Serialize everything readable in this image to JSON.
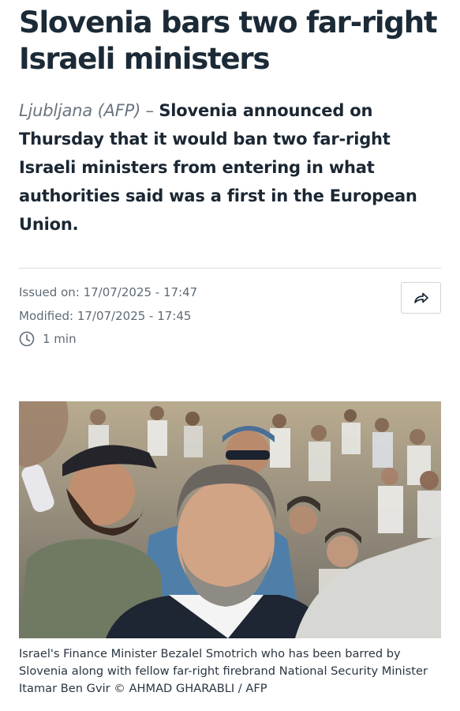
{
  "article": {
    "headline": "Slovenia bars two far-right Israeli ministers",
    "dateline": "Ljubljana (AFP)",
    "dash": " – ",
    "lede": "Slovenia announced on Thursday that it would ban two far-right Israeli ministers from entering in what authorities said was a first in the European Union.",
    "issued": "Issued on: 17/07/2025 - 17:47",
    "modified": "Modified: 17/07/2025 - 17:45",
    "read_time": "1 min",
    "caption": "Israel's Finance Minister Bezalel Smotrich who has been barred by Slovenia along with fellow far-right firebrand National Security Minister Itamar Ben Gvir © AHMAD GHARABLI / AFP"
  },
  "icons": {
    "share": "share-arrow-icon",
    "clock": "clock-icon"
  },
  "colors": {
    "headline": "#1b2a36",
    "meta": "#5f6b76",
    "divider": "#d9dde1"
  }
}
